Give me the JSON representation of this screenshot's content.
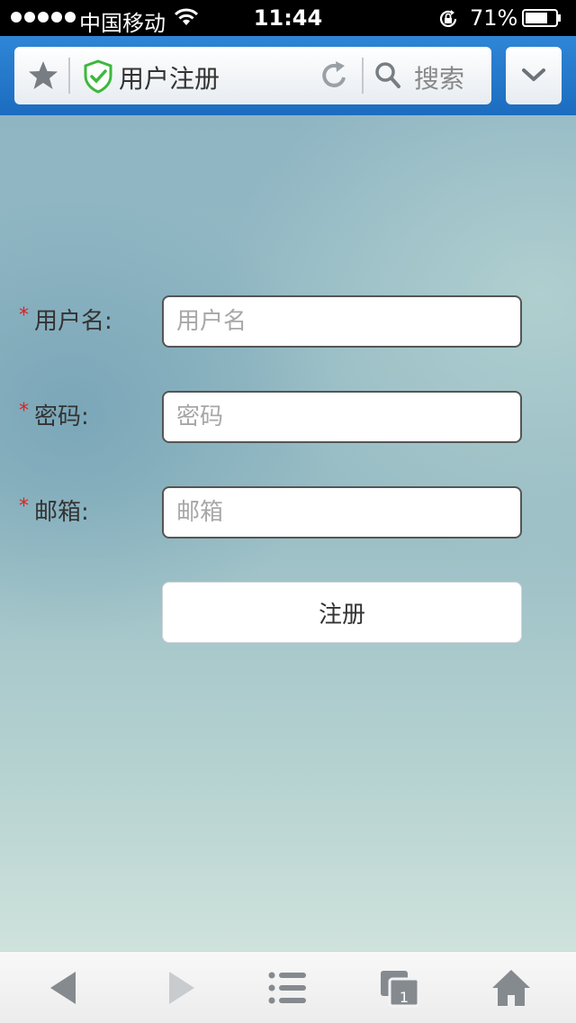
{
  "status_bar": {
    "carrier": "中国移动",
    "time": "11:44",
    "battery": "71%"
  },
  "browser": {
    "page_title": "用户注册",
    "search_label": "搜索",
    "accent_color": "#1c6cc0",
    "secure_color": "#3cb83c"
  },
  "form": {
    "required_mark": "*",
    "fields": [
      {
        "label": "用户名:",
        "placeholder": "用户名",
        "value": ""
      },
      {
        "label": "密码:",
        "placeholder": "密码",
        "value": ""
      },
      {
        "label": "邮箱:",
        "placeholder": "邮箱",
        "value": ""
      }
    ],
    "submit_label": "注册"
  },
  "toolbar": {
    "icons": [
      "back-icon",
      "forward-icon",
      "menu-list-icon",
      "tabs-icon",
      "home-icon"
    ],
    "tab_count": "1"
  }
}
